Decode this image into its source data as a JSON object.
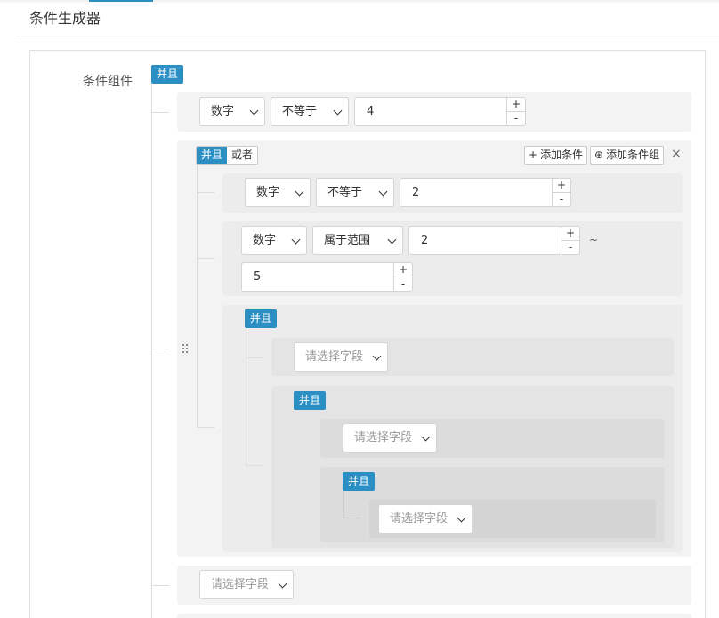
{
  "page": {
    "title": "条件生成器"
  },
  "form": {
    "label": "条件组件"
  },
  "root": {
    "conj": "并且",
    "cond1": {
      "field": "数字",
      "op": "不等于",
      "value": "4"
    }
  },
  "group1": {
    "conj_and": "并且",
    "conj_or": "或者",
    "add_condition": "添加条件",
    "add_group": "添加条件组",
    "cond1": {
      "field": "数字",
      "op": "不等于",
      "value": "2"
    },
    "cond2": {
      "field": "数字",
      "op": "属于范围",
      "from": "2",
      "sep": "~",
      "to": "5"
    },
    "sub": {
      "conj": "并且",
      "field_placeholder": "请选择字段",
      "sub": {
        "conj": "并且",
        "field_placeholder": "请选择字段",
        "sub": {
          "conj": "并且",
          "field_placeholder": "请选择字段"
        }
      }
    }
  },
  "root_last": {
    "field_placeholder": "请选择字段"
  },
  "stepper": {
    "plus": "+",
    "minus": "-"
  },
  "icons": {
    "close": "×",
    "plus": "+",
    "add_group": "⊕"
  },
  "colors": {
    "accent": "#2b8fc4"
  }
}
